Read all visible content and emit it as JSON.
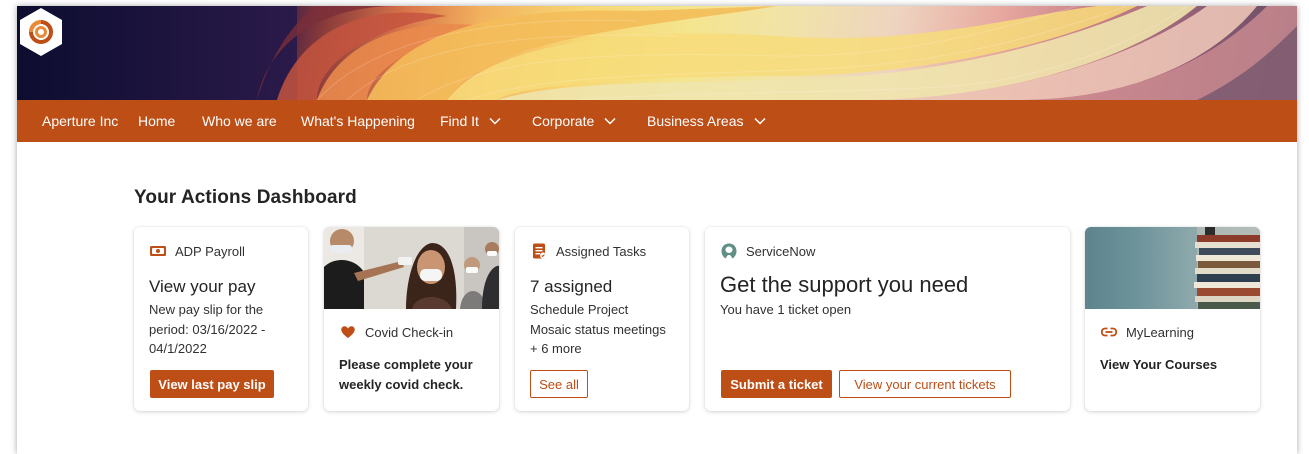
{
  "brand": {
    "name": "Aperture Inc",
    "accent": "#bd4e16"
  },
  "nav": {
    "items": [
      {
        "label": "Aperture Inc",
        "dropdown": false
      },
      {
        "label": "Home",
        "dropdown": false
      },
      {
        "label": "Who we are",
        "dropdown": false
      },
      {
        "label": "What's Happening",
        "dropdown": false
      },
      {
        "label": "Find It",
        "dropdown": true
      },
      {
        "label": "Corporate",
        "dropdown": true
      },
      {
        "label": "Business Areas",
        "dropdown": true
      }
    ]
  },
  "dashboard": {
    "title": "Your Actions Dashboard",
    "payroll": {
      "source": "ADP Payroll",
      "icon": "payroll-icon",
      "title": "View your pay",
      "text_line1": "New pay slip for the",
      "text_line2": "period: 03/16/2022 -",
      "text_line3": "04/1/2022",
      "button": "View last pay slip"
    },
    "covid": {
      "source": "Covid Check-in",
      "icon": "heart-icon",
      "text_line1": "Please complete your",
      "text_line2": "weekly covid check."
    },
    "tasks": {
      "source": "Assigned Tasks",
      "icon": "tasks-icon",
      "title": "7 assigned",
      "item1": "Schedule Project",
      "item2": "Mosaic status meetings",
      "more": "+ 6 more",
      "button": "See all"
    },
    "servicenow": {
      "source": "ServiceNow",
      "icon": "servicenow-icon",
      "title": "Get the support you need",
      "text": "You have 1 ticket open",
      "primary_button": "Submit a ticket",
      "secondary_button": "View your current tickets"
    },
    "learning": {
      "source": "MyLearning",
      "icon": "link-icon",
      "text": "View Your Courses"
    }
  }
}
